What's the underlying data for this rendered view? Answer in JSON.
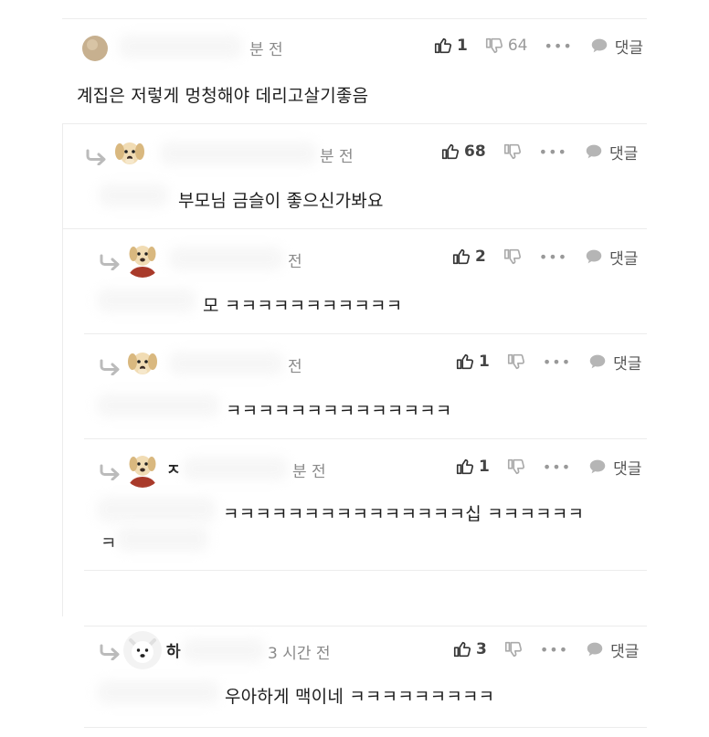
{
  "comments": [
    {
      "author": "",
      "time": "분 전",
      "likes": "1",
      "dislikes": "64",
      "reply_label": "댓글",
      "text": "계집은 저렇게 멍청해야 데리고살기좋음",
      "text2": ""
    },
    {
      "author": "",
      "time": "분 전",
      "likes": "68",
      "dislikes": "",
      "reply_label": "댓글",
      "text": "부모님 금슬이 좋으신가봐요",
      "text2": ""
    },
    {
      "author": "",
      "time": "전",
      "likes": "2",
      "dislikes": "",
      "reply_label": "댓글",
      "text": "모 ㅋㅋㅋㅋㅋㅋㅋㅋㅋㅋㅋ",
      "text2": ""
    },
    {
      "author": "",
      "time": "전",
      "likes": "1",
      "dislikes": "",
      "reply_label": "댓글",
      "text": "ㅋㅋㅋㅋㅋㅋㅋㅋㅋㅋㅋㅋㅋㅋ",
      "text2": ""
    },
    {
      "author": "ㅈ",
      "time": "분 전",
      "likes": "1",
      "dislikes": "",
      "reply_label": "댓글",
      "text": "ㅋㅋㅋㅋㅋㅋㅋㅋㅋㅋㅋㅋㅋㅋㅋ십 ㅋㅋㅋㅋㅋㅋ",
      "text2": "ㅋ"
    },
    {
      "author": "하",
      "time": "3 시간 전",
      "likes": "3",
      "dislikes": "",
      "reply_label": "댓글",
      "text": "우아하게 맥이네 ㅋㅋㅋㅋㅋㅋㅋㅋㅋ",
      "text2": ""
    }
  ],
  "more_label": "•••",
  "colors": {
    "icon": "#9a9a9a",
    "separator": "#ececec",
    "text": "#1c1c1c"
  }
}
